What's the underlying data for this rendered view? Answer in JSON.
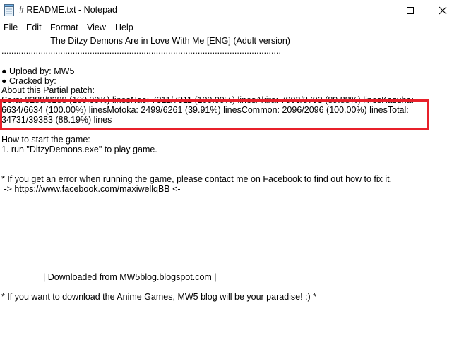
{
  "window": {
    "title": "# README.txt - Notepad",
    "app_icon": "notepad-icon",
    "controls": [
      "minimize-icon",
      "maximize-icon",
      "close-icon"
    ]
  },
  "menu": [
    "File",
    "Edit",
    "Format",
    "View",
    "Help"
  ],
  "document": {
    "title_line": "                    The Ditzy Demons Are in Love With Me [ENG] (Adult version)",
    "separator": "..................................................................................................................",
    "upload": "● Upload by: MW5",
    "cracked": "● Cracked by:",
    "about": "About this Partial patch:",
    "patch_line1": "Sora: 8288/8288 (100.00%) linesNao: 7311/7311 (100.00%) linesAkira: 7903/8793 (89.88%) linesKazuha:",
    "patch_line2": "6634/6634 (100.00%) linesMotoka: 2499/6261 (39.91%) linesCommon: 2096/2096 (100.00%) linesTotal:",
    "patch_line3": "34731/39383 (88.19%) lines",
    "howto": "How to start the game:",
    "step1": "1. run \"DitzyDemons.exe\" to play game.",
    "error_note": "* If you get an error when running the game, please contact me on Facebook to find out how to fix it.",
    "facebook": " -> https://www.facebook.com/maxiwellqBB <-",
    "downloaded": "                 | Downloaded from MW5blog.blogspot.com |",
    "paradise": "* If you want to download the Anime Games, MW5 blog will be your paradise! :) *"
  },
  "colors": {
    "highlight": "#e8202a"
  }
}
